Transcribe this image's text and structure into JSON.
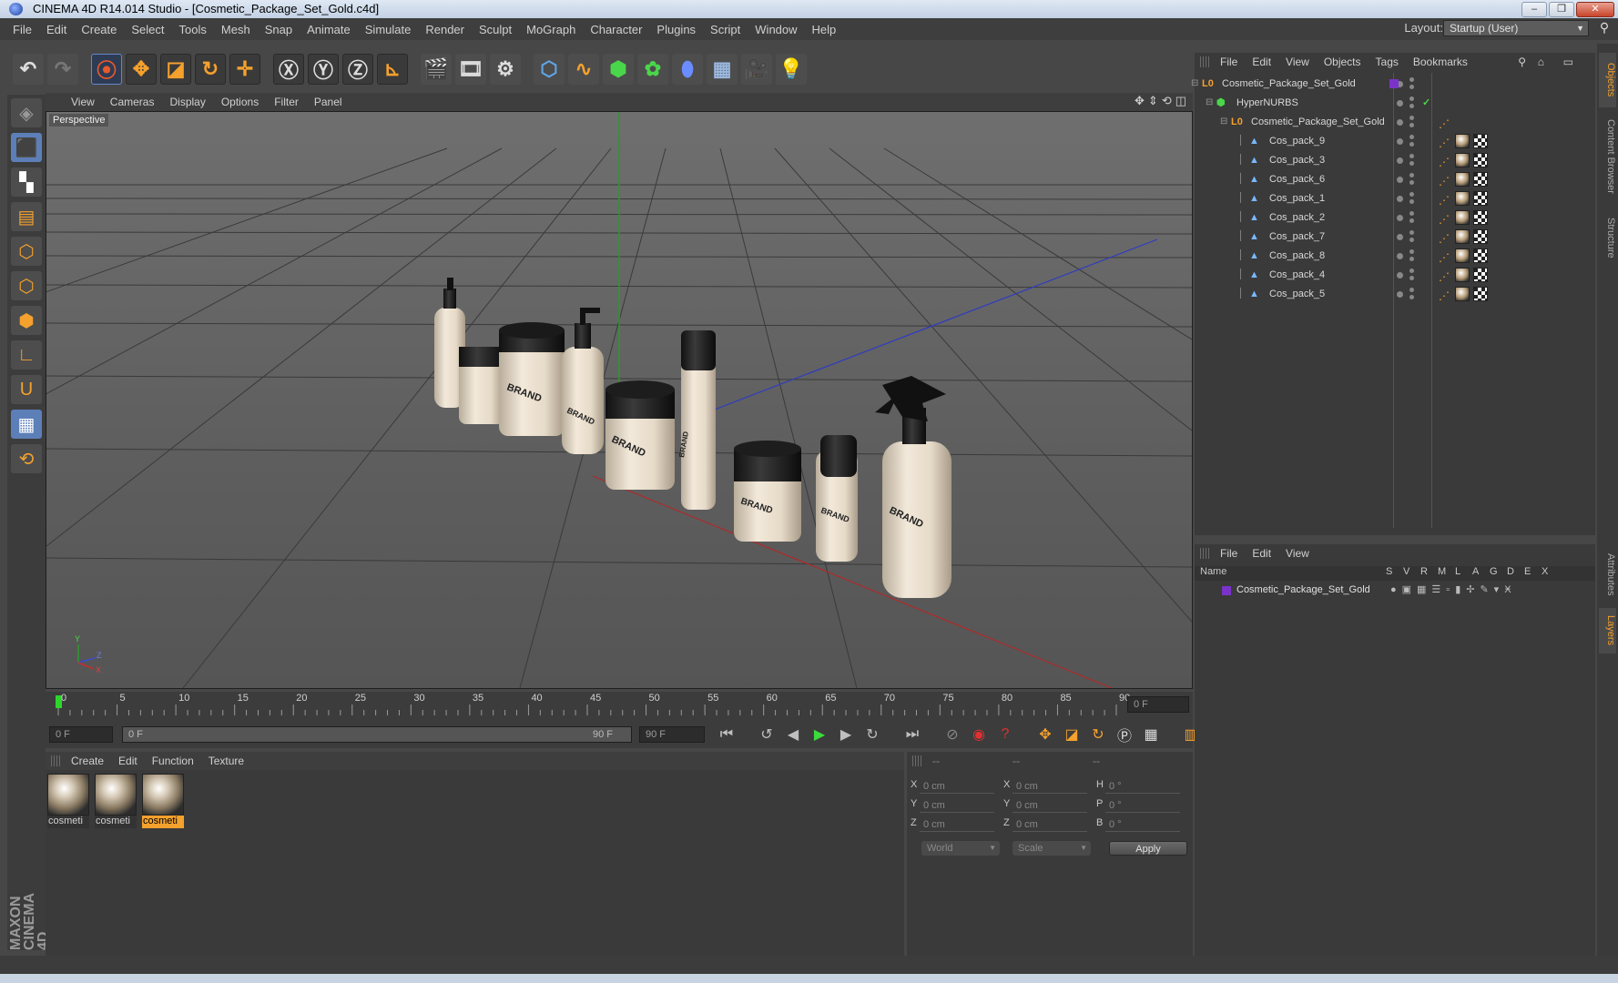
{
  "window": {
    "title": "CINEMA 4D R14.014 Studio - [Cosmetic_Package_Set_Gold.c4d]"
  },
  "menu": [
    "File",
    "Edit",
    "Create",
    "Select",
    "Tools",
    "Mesh",
    "Snap",
    "Animate",
    "Simulate",
    "Render",
    "Sculpt",
    "MoGraph",
    "Character",
    "Plugins",
    "Script",
    "Window",
    "Help"
  ],
  "layout": {
    "label": "Layout:",
    "value": "Startup (User)"
  },
  "viewport": {
    "menu": [
      "View",
      "Cameras",
      "Display",
      "Options",
      "Filter",
      "Panel"
    ],
    "label": "Perspective",
    "axis_labels": {
      "y": "Y",
      "z": "Z",
      "x": "X"
    },
    "brand_text": "BRAND"
  },
  "timeline": {
    "ticks": [
      "0",
      "5",
      "10",
      "15",
      "20",
      "25",
      "30",
      "35",
      "40",
      "45",
      "50",
      "55",
      "60",
      "65",
      "70",
      "75",
      "80",
      "85",
      "90"
    ],
    "current_frame": "0 F",
    "start_field": "0 F",
    "range_start": "0 F",
    "range_end": "90 F",
    "end_field": "90 F"
  },
  "material_panel": {
    "menu": [
      "Create",
      "Edit",
      "Function",
      "Texture"
    ],
    "materials": [
      {
        "label": "cosmeti",
        "selected": false
      },
      {
        "label": "cosmeti",
        "selected": false
      },
      {
        "label": "cosmeti",
        "selected": true
      }
    ]
  },
  "coord_panel": {
    "headers": [
      "--",
      "--",
      "--"
    ],
    "rows": [
      {
        "a": "X",
        "va": "0 cm",
        "b": "X",
        "vb": "0 cm",
        "c": "H",
        "vc": "0 °"
      },
      {
        "a": "Y",
        "va": "0 cm",
        "b": "Y",
        "vb": "0 cm",
        "c": "P",
        "vc": "0 °"
      },
      {
        "a": "Z",
        "va": "0 cm",
        "b": "Z",
        "vb": "0 cm",
        "c": "B",
        "vc": "0 °"
      }
    ],
    "world": "World",
    "scale": "Scale",
    "apply": "Apply"
  },
  "object_manager": {
    "menu": [
      "File",
      "Edit",
      "View",
      "Objects",
      "Tags",
      "Bookmarks"
    ],
    "root": "Cosmetic_Package_Set_Gold",
    "nurbs": "HyperNURBS",
    "group": "Cosmetic_Package_Set_Gold",
    "items": [
      "Cos_pack_9",
      "Cos_pack_3",
      "Cos_pack_6",
      "Cos_pack_1",
      "Cos_pack_2",
      "Cos_pack_7",
      "Cos_pack_8",
      "Cos_pack_4",
      "Cos_pack_5"
    ]
  },
  "layer_manager": {
    "menu": [
      "File",
      "Edit",
      "View"
    ],
    "columns": [
      "Name",
      "S",
      "V",
      "R",
      "M",
      "L",
      "A",
      "G",
      "D",
      "E",
      "X"
    ],
    "layer_name": "Cosmetic_Package_Set_Gold",
    "layer_color": "#7a33c9"
  },
  "right_tabs": [
    "Objects",
    "Content Browser",
    "Structure",
    "Attributes",
    "Layers"
  ],
  "brand": {
    "line1": "MAXON",
    "line2": "CINEMA 4D"
  },
  "colors": {
    "accent_orange": "#f4a12d",
    "selection_blue": "#5d7fb8",
    "playhead_green": "#2bd62b"
  }
}
